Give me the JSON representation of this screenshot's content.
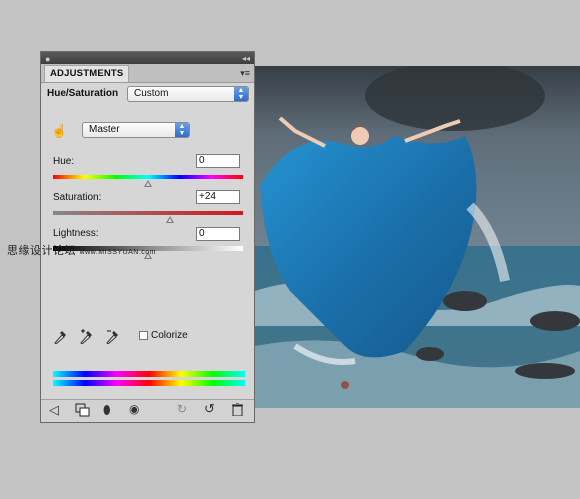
{
  "panel": {
    "tab_label": "ADJUSTMENTS",
    "adjustment_label": "Hue/Saturation",
    "preset_value": "Custom",
    "channel_value": "Master",
    "hue_label": "Hue:",
    "hue_value": "0",
    "saturation_label": "Saturation:",
    "saturation_value": "+24",
    "lightness_label": "Lightness:",
    "lightness_value": "0",
    "colorize_label": "Colorize",
    "colorize_checked": false
  },
  "watermark": {
    "text": "思缘设计论坛",
    "url": "www.MISSYUAN.com"
  },
  "icons": [
    "hand-adjust-icon",
    "eyedropper-icon",
    "eyedropper-plus-icon",
    "eyedropper-minus-icon",
    "back-arrow-icon",
    "expand-view-icon",
    "layer-mask-icon",
    "visibility-eye-icon",
    "view-previous-icon",
    "reset-icon",
    "trash-icon"
  ],
  "colors": {
    "accent": "#2f6ad0",
    "saturation_bar": "#d4161b"
  }
}
